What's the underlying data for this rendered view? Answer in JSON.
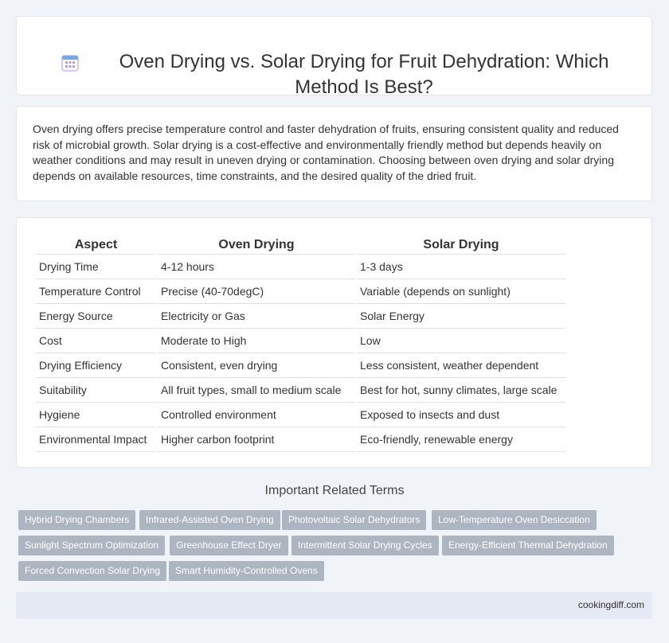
{
  "header": {
    "title": "Oven Drying vs. Solar Drying for Fruit Dehydration: Which Method Is Best?",
    "icon": "calendar-grid-icon"
  },
  "intro": {
    "text": "Oven drying offers precise temperature control and faster dehydration of fruits, ensuring consistent quality and reduced risk of microbial growth. Solar drying is a cost-effective and environmentally friendly method but depends heavily on weather conditions and may result in uneven drying or contamination. Choosing between oven drying and solar drying depends on available resources, time constraints, and the desired quality of the dried fruit."
  },
  "table": {
    "headers": [
      "Aspect",
      "Oven Drying",
      "Solar Drying"
    ],
    "rows": [
      [
        "Drying Time",
        "4-12 hours",
        "1-3 days"
      ],
      [
        "Temperature Control",
        "Precise (40-70degC)",
        "Variable (depends on sunlight)"
      ],
      [
        "Energy Source",
        "Electricity or Gas",
        "Solar Energy"
      ],
      [
        "Cost",
        "Moderate to High",
        "Low"
      ],
      [
        "Drying Efficiency",
        "Consistent, even drying",
        "Less consistent, weather dependent"
      ],
      [
        "Suitability",
        "All fruit types, small to medium scale",
        "Best for hot, sunny climates, large scale"
      ],
      [
        "Hygiene",
        "Controlled environment",
        "Exposed to insects and dust"
      ],
      [
        "Environmental Impact",
        "Higher carbon footprint",
        "Eco-friendly, renewable energy"
      ]
    ]
  },
  "related": {
    "title": "Important Related Terms",
    "tags": [
      "Hybrid Drying Chambers",
      "Infrared-Assisted Oven Drying",
      "Photovoltaic Solar Dehydrators",
      "Low-Temperature Oven Desiccation",
      "Sunlight Spectrum Optimization",
      "Greenhouse Effect Dryer",
      "Intermittent Solar Drying Cycles",
      "Energy-Efficient Thermal Dehydration",
      "Forced Convection Solar Drying",
      "Smart Humidity-Controlled Ovens"
    ]
  },
  "footer": {
    "site": "cookingdiff.com"
  },
  "colors": {
    "tag_bg": "#adb5c0",
    "page_bg": "#f0f3f8",
    "footer_bg": "#e5e9f3"
  }
}
